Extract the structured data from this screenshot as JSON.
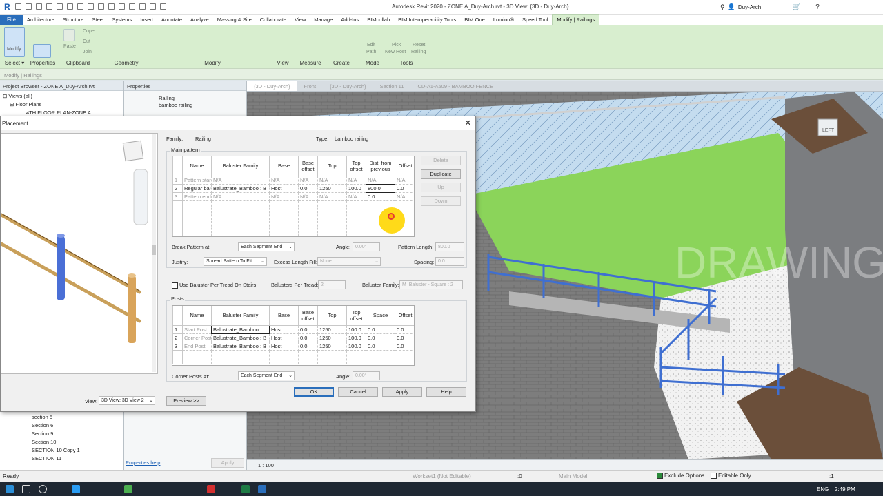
{
  "app": {
    "title": "Autodesk Revit 2020 - ZONE A_Duy-Arch.rvt - 3D View: {3D - Duy-Arch}",
    "user": "Duy-Arch",
    "logo": "R"
  },
  "menu": {
    "file": "File",
    "tabs": [
      "Architecture",
      "Structure",
      "Steel",
      "Systems",
      "Insert",
      "Annotate",
      "Analyze",
      "Massing & Site",
      "Collaborate",
      "View",
      "Manage",
      "Add-Ins",
      "BIMcollab",
      "BIM Interoperability Tools",
      "BIM One",
      "Lumion®",
      "Speed Tool",
      "Modify | Railings"
    ]
  },
  "ribbon": {
    "select": {
      "modify": "Modify",
      "label": "Select ▾"
    },
    "properties": {
      "label": "Properties"
    },
    "clipboard": {
      "paste": "Paste",
      "label": "Clipboard",
      "cope": "Cope",
      "cut": "Cut",
      "join": "Join"
    },
    "geometry": {
      "label": "Geometry"
    },
    "modify": {
      "label": "Modify"
    },
    "view": {
      "label": "View"
    },
    "measure": {
      "label": "Measure"
    },
    "create": {
      "label": "Create"
    },
    "mode": {
      "edit": "Edit",
      "path": "Path",
      "label": "Mode"
    },
    "tools": {
      "pick": "Pick",
      "newhost": "New Host",
      "reset": "Reset",
      "railing": "Railing",
      "label": "Tools"
    }
  },
  "context_bar": "Modify | Railings",
  "project_browser": {
    "title": "Project Browser - ZONE A_Duy-Arch.rvt",
    "views": "Views (all)",
    "floor_plans": "Floor Plans",
    "item": "4TH FLOOR PLAN-ZONE A",
    "sections": [
      "section 5",
      "Section 6",
      "Section 9",
      "Section 10",
      "SECTION 10 Copy 1",
      "SECTION 11"
    ]
  },
  "properties_panel": {
    "title": "Properties",
    "type1": "Railing",
    "type2": "bamboo railing",
    "help": "Properties help",
    "apply": "Apply"
  },
  "view_tabs": [
    "{3D - Duy-Arch}",
    "Front",
    "{3D - Duy-Arch}",
    "Section 11",
    "CD-A1-A509 - BAMBOO FENCE"
  ],
  "dialog": {
    "title": "Placement",
    "family_label": "Family:",
    "family": "Railing",
    "type_label": "Type:",
    "type": "bamboo railing",
    "main_pattern": "Main pattern",
    "main_headers": [
      "",
      "Name",
      "Baluster Family",
      "Base",
      "Base offset",
      "Top",
      "Top offset",
      "Dist. from previous",
      "Offset"
    ],
    "main_rows": [
      [
        "1",
        "Pattern start",
        "N/A",
        "N/A",
        "N/A",
        "N/A",
        "N/A",
        "N/A",
        "N/A"
      ],
      [
        "2",
        "Regular baluster",
        "Balustrate_Bamboo : B",
        "Host",
        "0.0",
        "1250",
        "100.0",
        "800.0",
        "0.0"
      ],
      [
        "3",
        "Pattern end",
        "N/A",
        "N/A",
        "N/A",
        "N/A",
        "N/A",
        "0.0",
        "N/A"
      ]
    ],
    "buttons_side": [
      "Delete",
      "Duplicate",
      "Up",
      "Down"
    ],
    "break_label": "Break Pattern at:",
    "break_value": "Each Segment End",
    "angle_label": "Angle:",
    "angle_value": "0.00°",
    "pattern_length_label": "Pattern Length:",
    "pattern_length": "800.0",
    "justify_label": "Justify:",
    "justify_value": "Spread Pattern To Fit",
    "excess_label": "Excess Length Fill:",
    "excess_value": "None",
    "spacing_label": "Spacing:",
    "spacing_value": "0.0",
    "use_baluster": "Use Baluster Per Tread On Stairs",
    "per_tread_label": "Balusters Per Tread:",
    "per_tread_value": "2",
    "bal_family_label": "Baluster Family:",
    "bal_family_value": "M_Baluster - Square : 2",
    "posts": "Posts",
    "posts_headers": [
      "",
      "Name",
      "Baluster Family",
      "Base",
      "Base offset",
      "Top",
      "Top offset",
      "Space",
      "Offset"
    ],
    "posts_rows": [
      [
        "1",
        "Start Post",
        "Balustrate_Bamboo :",
        "Host",
        "0.0",
        "1250",
        "100.0",
        "0.0",
        "0.0"
      ],
      [
        "2",
        "Corner Post",
        "Balustrate_Bamboo : B",
        "Host",
        "0.0",
        "1250",
        "100.0",
        "0.0",
        "0.0"
      ],
      [
        "3",
        "End Post",
        "Balustrate_Bamboo : B",
        "Host",
        "0.0",
        "1250",
        "100.0",
        "0.0",
        "0.0"
      ]
    ],
    "corner_label": "Corner Posts At:",
    "corner_value": "Each Segment End",
    "corner_angle": "0.00°",
    "view_label": "View:",
    "view_value": "3D View: 3D View 2",
    "preview_btn": "Preview >>",
    "ok": "OK",
    "cancel": "Cancel",
    "apply": "Apply",
    "help": "Help"
  },
  "viewport": {
    "scale": "1 : 100",
    "watermark": "DRAWING",
    "cube": "LEFT"
  },
  "status": {
    "ready": "Ready",
    "workset": "Workset1 (Not Editable)",
    "count": ":0",
    "model": "Main Model",
    "exclude": "Exclude Options",
    "editable": "Editable Only",
    "filter": ":1"
  },
  "taskbar": {
    "lang": "ENG",
    "time": "2:49 PM"
  }
}
